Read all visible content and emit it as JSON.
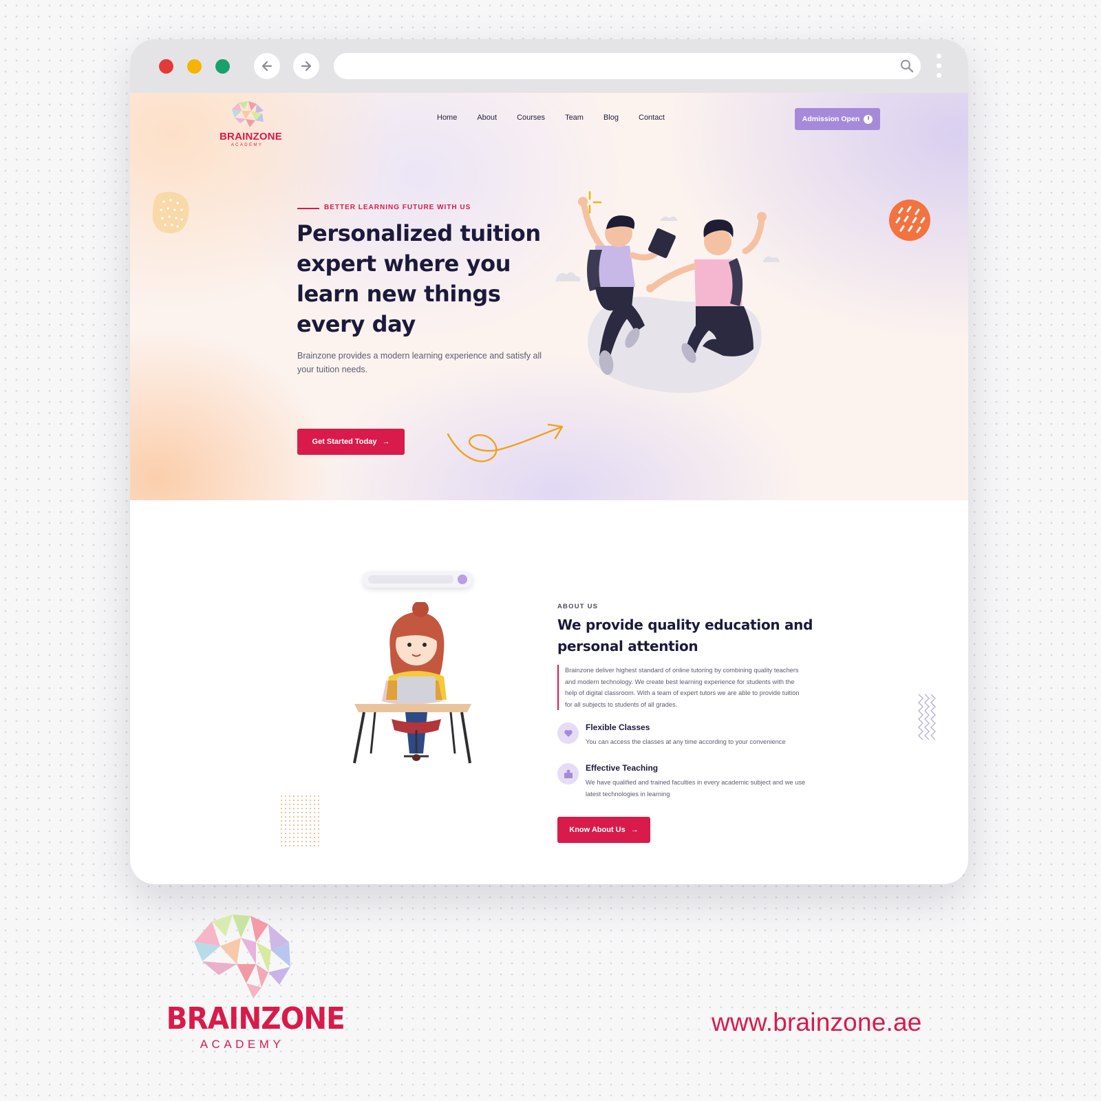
{
  "browser": {
    "url": "",
    "back_icon": "arrow-left-icon",
    "forward_icon": "arrow-right-icon",
    "search_icon": "search-icon",
    "menu_icon": "kebab-menu-icon",
    "window_dots": [
      "#e5383b",
      "#f4b400",
      "#1aa06d"
    ]
  },
  "header": {
    "logo_brand": "BRAINZONE",
    "logo_sub": "ACADEMY",
    "nav": [
      "Home",
      "About",
      "Courses",
      "Team",
      "Blog",
      "Contact"
    ],
    "admission_label": "Admission Open"
  },
  "hero": {
    "eyebrow": "BETTER LEARNING FUTURE WITH US",
    "title": "Personalized tuition expert where you learn new things every day",
    "description": "Brainzone provides a modern learning experience and satisfy all your tuition needs.",
    "cta_label": "Get Started Today"
  },
  "about": {
    "eyebrow": "ABOUT US",
    "title": "We provide quality education and personal attention",
    "text": "Brainzone deliver highest standard of online tutoring by combining quality teachers and modern technology. We create best learning experience for students with the help of digital classroom. With a team of expert tutors we are able to provide tuition for all subjects to students of all grades.",
    "features": [
      {
        "title": "Flexible Classes",
        "description": "You can access the classes at any time according to your convenience"
      },
      {
        "title": "Effective Teaching",
        "description": "We have qualified and trained faculties in every academic subject and we use latest technologies in learning"
      }
    ],
    "cta_label": "Know About Us"
  },
  "footer": {
    "logo_brand": "BRAINZONE",
    "logo_sub": "ACADEMY",
    "website": "www.brainzone.ae"
  },
  "colors": {
    "brand_red": "#d81b4a",
    "accent_purple": "#a68ad9",
    "heading": "#1b1a3b"
  }
}
